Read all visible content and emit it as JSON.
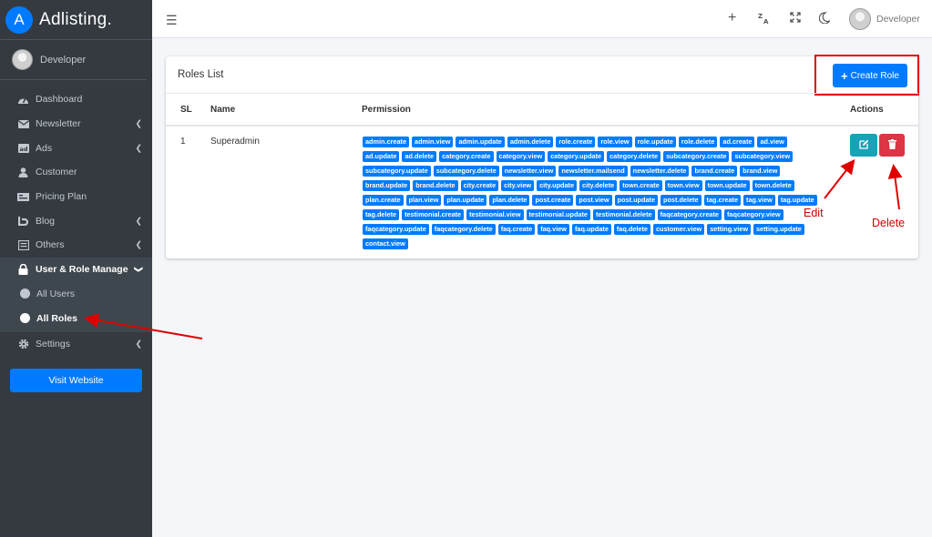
{
  "brand": {
    "logo_letter": "A",
    "name": "Adlisting."
  },
  "user": {
    "name": "Developer"
  },
  "sidebar": {
    "items": [
      {
        "label": "Dashboard",
        "icon": "dashboard-icon"
      },
      {
        "label": "Newsletter",
        "icon": "envelope-icon",
        "chevron": true
      },
      {
        "label": "Ads",
        "icon": "ad-icon",
        "chevron": true
      },
      {
        "label": "Customer",
        "icon": "user-icon"
      },
      {
        "label": "Pricing Plan",
        "icon": "money-bill-icon"
      },
      {
        "label": "Blog",
        "icon": "blog-icon",
        "chevron": true
      },
      {
        "label": "Others",
        "icon": "list-icon",
        "chevron": true
      },
      {
        "label": "User & Role Manage",
        "icon": "lock-icon",
        "chevron": true
      },
      {
        "label": "Settings",
        "icon": "gear-icon",
        "chevron": true
      }
    ],
    "submenu": [
      {
        "label": "All Users"
      },
      {
        "label": "All Roles"
      }
    ],
    "visit_label": "Visit Website"
  },
  "header": {
    "user_name": "Developer",
    "icons": [
      "plus-icon",
      "translate-icon",
      "fullscreen-icon",
      "moon-icon"
    ]
  },
  "card": {
    "title": "Roles List",
    "create_label": "Create Role",
    "columns": [
      "SL",
      "Name",
      "Permission",
      "Actions"
    ],
    "rows": [
      {
        "sl": "1",
        "name": "Superadmin",
        "permissions": [
          "admin.create",
          "admin.view",
          "admin.update",
          "admin.delete",
          "role.create",
          "role.view",
          "role.update",
          "role.delete",
          "ad.create",
          "ad.view",
          "ad.update",
          "ad.delete",
          "category.create",
          "category.view",
          "category.update",
          "category.delete",
          "subcategory.create",
          "subcategory.view",
          "subcategory.update",
          "subcategory.delete",
          "newsletter.view",
          "newsletter.mailsend",
          "newsletter.delete",
          "brand.create",
          "brand.view",
          "brand.update",
          "brand.delete",
          "city.create",
          "city.view",
          "city.update",
          "city.delete",
          "town.create",
          "town.view",
          "town.update",
          "town.delete",
          "plan.create",
          "plan.view",
          "plan.update",
          "plan.delete",
          "post.create",
          "post.view",
          "post.update",
          "post.delete",
          "tag.create",
          "tag.view",
          "tag.update",
          "tag.delete",
          "testimonial.create",
          "testimonial.view",
          "testimonial.update",
          "testimonial.delete",
          "faqcategory.create",
          "faqcategory.view",
          "faqcategory.update",
          "faqcategory.delete",
          "faq.create",
          "faq.view",
          "faq.update",
          "faq.delete",
          "customer.view",
          "setting.view",
          "setting.update",
          "contact.view"
        ]
      }
    ]
  },
  "annotations": {
    "edit": "Edit",
    "delete": "Delete",
    "color": "#d00000"
  }
}
